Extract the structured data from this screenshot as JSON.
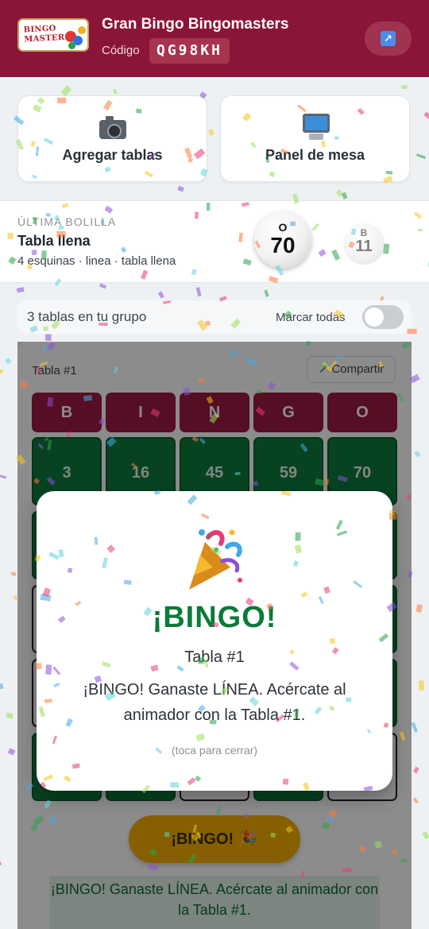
{
  "header": {
    "logo_text_line1": "BINGO",
    "logo_text_line2": "MASTERS",
    "title": "Gran Bingo Bingomasters",
    "code_label": "Código",
    "code_value": "QG98KH",
    "external_icon": "external-link-icon"
  },
  "actions": {
    "add_tables": {
      "icon": "camera-icon",
      "label": "Agregar tablas"
    },
    "table_panel": {
      "icon": "computer-icon",
      "label": "Panel de mesa"
    }
  },
  "last_ball": {
    "kicker": "ÚLTIMA BOLILLA",
    "pattern_title": "Tabla llena",
    "patterns": "4 esquinas · linea · tabla llena",
    "current": {
      "letter": "O",
      "number": "70"
    },
    "previous": {
      "letter": "B",
      "number": "11"
    }
  },
  "group": {
    "count_text": "3 tablas en tu grupo",
    "mark_all_label": "Marcar todas",
    "mark_all_on": false
  },
  "table": {
    "title": "Tabla #1",
    "share_label": "↗ Compartir",
    "headers": [
      "B",
      "I",
      "N",
      "G",
      "O"
    ],
    "rows": [
      [
        {
          "value": "3",
          "marked": true
        },
        {
          "value": "16",
          "marked": true
        },
        {
          "value": "45",
          "marked": true
        },
        {
          "value": "59",
          "marked": true
        },
        {
          "value": "70",
          "marked": true
        }
      ],
      [
        {
          "value": "",
          "marked": true
        },
        {
          "value": "",
          "marked": false
        },
        {
          "value": "",
          "marked": false
        },
        {
          "value": "",
          "marked": false
        },
        {
          "value": "",
          "marked": true
        }
      ],
      [
        {
          "value": "",
          "marked": false
        },
        {
          "value": "",
          "marked": false
        },
        {
          "value": "",
          "marked": false
        },
        {
          "value": "",
          "marked": false
        },
        {
          "value": "",
          "marked": true
        }
      ],
      [
        {
          "value": "",
          "marked": false
        },
        {
          "value": "",
          "marked": false
        },
        {
          "value": "",
          "marked": false
        },
        {
          "value": "",
          "marked": false
        },
        {
          "value": "",
          "marked": true
        }
      ],
      [
        {
          "value": "",
          "marked": true
        },
        {
          "value": "",
          "marked": true
        },
        {
          "value": "",
          "marked": false
        },
        {
          "value": "",
          "marked": true
        },
        {
          "value": "",
          "marked": false
        }
      ]
    ],
    "bingo_button": "¡BINGO! 🎉",
    "status_message": "¡BINGO! Ganaste LÍNEA. Acércate al animador con la Tabla #1."
  },
  "modal": {
    "icon": "party-popper-icon",
    "title": "¡BINGO!",
    "table": "Tabla #1",
    "message": "¡BINGO! Ganaste LÍNEA. Acércate al animador con la Tabla #1.",
    "hint": "(toca para cerrar)"
  },
  "colors": {
    "header_bg": "#8b1538",
    "bingo_green": "#0b7a3a",
    "cell_marked": "#0e7a3c",
    "header_cell": "#9b1a40",
    "bingo_button": "#f4b000"
  }
}
